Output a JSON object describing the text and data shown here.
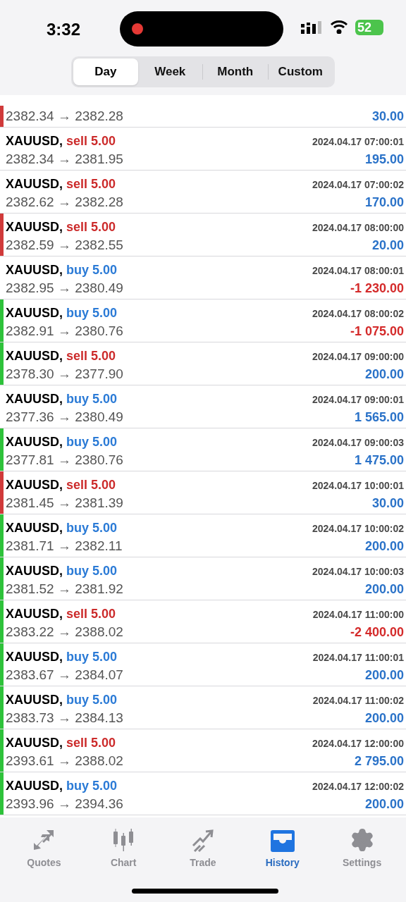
{
  "status_bar": {
    "time": "3:32",
    "battery": "52"
  },
  "tabs": [
    {
      "label": "Day",
      "selected": true
    },
    {
      "label": "Week",
      "selected": false
    },
    {
      "label": "Month",
      "selected": false
    },
    {
      "label": "Custom",
      "selected": false
    }
  ],
  "deals": [
    {
      "kind": "continuation",
      "marker": {
        "color": "#d03a3a"
      },
      "prices": "2382.34 → 2382.28",
      "profit": {
        "text": "30.00",
        "color": "#2a72c8"
      }
    },
    {
      "kind": "full",
      "symbol": "XAUUSD,",
      "volume": {
        "text": "sell 5.00",
        "color": "#cc2b2b"
      },
      "time": "2024.04.17 07:00:01",
      "prices": "2382.34 → 2381.95",
      "profit": {
        "text": "195.00",
        "color": "#2a72c8"
      }
    },
    {
      "kind": "full",
      "symbol": "XAUUSD,",
      "volume": {
        "text": "sell 5.00",
        "color": "#cc2b2b"
      },
      "time": "2024.04.17 07:00:02",
      "prices": "2382.62 → 2382.28",
      "profit": {
        "text": "170.00",
        "color": "#2a72c8"
      }
    },
    {
      "kind": "full",
      "marker": {
        "color": "#d03a3a"
      },
      "symbol": "XAUUSD,",
      "volume": {
        "text": "sell 5.00",
        "color": "#cc2b2b"
      },
      "time": "2024.04.17 08:00:00",
      "prices": "2382.59 → 2382.55",
      "profit": {
        "text": "20.00",
        "color": "#2a72c8"
      }
    },
    {
      "kind": "full",
      "symbol": "XAUUSD,",
      "volume": {
        "text": "buy 5.00",
        "color": "#2a7ad6"
      },
      "time": "2024.04.17 08:00:01",
      "prices": "2382.95 → 2380.49",
      "profit": {
        "text": "-1 230.00",
        "color": "#d42a2a"
      }
    },
    {
      "kind": "full",
      "marker": {
        "color": "#2ec23a"
      },
      "symbol": "XAUUSD,",
      "volume": {
        "text": "buy 5.00",
        "color": "#2a7ad6"
      },
      "time": "2024.04.17 08:00:02",
      "prices": "2382.91 → 2380.76",
      "profit": {
        "text": "-1 075.00",
        "color": "#d42a2a"
      }
    },
    {
      "kind": "full",
      "marker": {
        "color": "#2ec23a"
      },
      "symbol": "XAUUSD,",
      "volume": {
        "text": "sell 5.00",
        "color": "#cc2b2b"
      },
      "time": "2024.04.17 09:00:00",
      "prices": "2378.30 → 2377.90",
      "profit": {
        "text": "200.00",
        "color": "#2a72c8"
      }
    },
    {
      "kind": "full",
      "symbol": "XAUUSD,",
      "volume": {
        "text": "buy 5.00",
        "color": "#2a7ad6"
      },
      "time": "2024.04.17 09:00:01",
      "prices": "2377.36 → 2380.49",
      "profit": {
        "text": "1 565.00",
        "color": "#2a72c8"
      }
    },
    {
      "kind": "full",
      "marker": {
        "color": "#2ec23a"
      },
      "symbol": "XAUUSD,",
      "volume": {
        "text": "buy 5.00",
        "color": "#2a7ad6"
      },
      "time": "2024.04.17 09:00:03",
      "prices": "2377.81 → 2380.76",
      "profit": {
        "text": "1 475.00",
        "color": "#2a72c8"
      }
    },
    {
      "kind": "full",
      "marker": {
        "color": "#d03a3a"
      },
      "symbol": "XAUUSD,",
      "volume": {
        "text": "sell 5.00",
        "color": "#cc2b2b"
      },
      "time": "2024.04.17 10:00:01",
      "prices": "2381.45 → 2381.39",
      "profit": {
        "text": "30.00",
        "color": "#2a72c8"
      }
    },
    {
      "kind": "full",
      "marker": {
        "color": "#2ec23a"
      },
      "symbol": "XAUUSD,",
      "volume": {
        "text": "buy 5.00",
        "color": "#2a7ad6"
      },
      "time": "2024.04.17 10:00:02",
      "prices": "2381.71 → 2382.11",
      "profit": {
        "text": "200.00",
        "color": "#2a72c8"
      }
    },
    {
      "kind": "full",
      "marker": {
        "color": "#2ec23a"
      },
      "symbol": "XAUUSD,",
      "volume": {
        "text": "buy 5.00",
        "color": "#2a7ad6"
      },
      "time": "2024.04.17 10:00:03",
      "prices": "2381.52 → 2381.92",
      "profit": {
        "text": "200.00",
        "color": "#2a72c8"
      }
    },
    {
      "kind": "full",
      "marker": {
        "color": "#2ec23a"
      },
      "symbol": "XAUUSD,",
      "volume": {
        "text": "sell 5.00",
        "color": "#cc2b2b"
      },
      "time": "2024.04.17 11:00:00",
      "prices": "2383.22 → 2388.02",
      "profit": {
        "text": "-2 400.00",
        "color": "#d42a2a"
      }
    },
    {
      "kind": "full",
      "marker": {
        "color": "#2ec23a"
      },
      "symbol": "XAUUSD,",
      "volume": {
        "text": "buy 5.00",
        "color": "#2a7ad6"
      },
      "time": "2024.04.17 11:00:01",
      "prices": "2383.67 → 2384.07",
      "profit": {
        "text": "200.00",
        "color": "#2a72c8"
      }
    },
    {
      "kind": "full",
      "marker": {
        "color": "#2ec23a"
      },
      "symbol": "XAUUSD,",
      "volume": {
        "text": "buy 5.00",
        "color": "#2a7ad6"
      },
      "time": "2024.04.17 11:00:02",
      "prices": "2383.73 → 2384.13",
      "profit": {
        "text": "200.00",
        "color": "#2a72c8"
      }
    },
    {
      "kind": "full",
      "marker": {
        "color": "#2ec23a"
      },
      "symbol": "XAUUSD,",
      "volume": {
        "text": "sell 5.00",
        "color": "#cc2b2b"
      },
      "time": "2024.04.17 12:00:00",
      "prices": "2393.61 → 2388.02",
      "profit": {
        "text": "2 795.00",
        "color": "#2a72c8"
      }
    },
    {
      "kind": "full",
      "marker": {
        "color": "#2ec23a"
      },
      "symbol": "XAUUSD,",
      "volume": {
        "text": "buy 5.00",
        "color": "#2a7ad6"
      },
      "time": "2024.04.17 12:00:02",
      "prices": "2393.96 → 2394.36",
      "profit": {
        "text": "200.00",
        "color": "#2a72c8"
      }
    }
  ],
  "tab_bar": [
    {
      "label": "Quotes",
      "selected": false
    },
    {
      "label": "Chart",
      "selected": false
    },
    {
      "label": "Trade",
      "selected": false
    },
    {
      "label": "History",
      "selected": true
    },
    {
      "label": "Settings",
      "selected": false
    }
  ]
}
